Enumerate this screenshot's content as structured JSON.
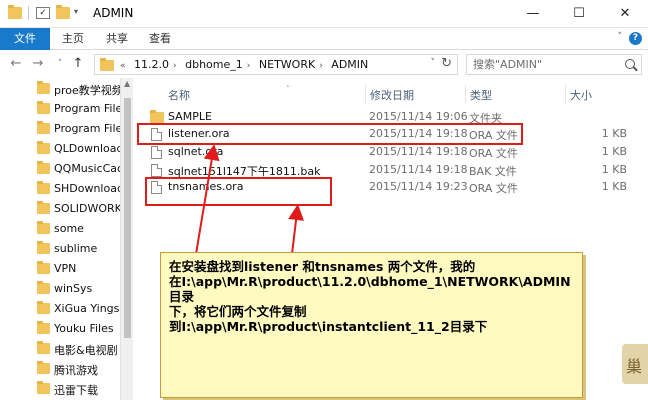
{
  "window": {
    "title": "ADMIN",
    "controls": {
      "minimize": "—",
      "maximize": "☐",
      "close": "✕"
    }
  },
  "ribbon": {
    "tabs": [
      "文件",
      "主页",
      "共享",
      "查看"
    ],
    "collapse_glyph": "˅",
    "help_glyph": "?"
  },
  "nav": {
    "back": "←",
    "forward": "→",
    "recent": "˅",
    "up": "↑",
    "overflow": "«",
    "breadcrumbs": [
      "11.2.0",
      "dbhome_1",
      "NETWORK",
      "ADMIN"
    ],
    "search_placeholder": "搜索\"ADMIN\""
  },
  "sidebar": {
    "items": [
      "proe教学视频",
      "Program Files",
      "Program Files",
      "QLDownload",
      "QQMusicCache",
      "SHDownload",
      "SOLIDWORKS",
      "some",
      "sublime",
      "VPN",
      "winSys",
      "XiGua Yingshi",
      "Youku Files",
      "电影&电视剧",
      "腾讯游戏",
      "迅雷下载"
    ]
  },
  "columns": {
    "name": "名称",
    "date": "修改日期",
    "type": "类型",
    "size": "大小"
  },
  "files": [
    {
      "name": "SAMPLE",
      "date": "2015/11/14 19:06",
      "type": "文件夹",
      "size": "",
      "icon": "folder"
    },
    {
      "name": "listener.ora",
      "date": "2015/11/14 19:18",
      "type": "ORA 文件",
      "size": "1 KB",
      "icon": "file"
    },
    {
      "name": "sqlnet.ora",
      "date": "2015/11/14 19:18",
      "type": "ORA 文件",
      "size": "1 KB",
      "icon": "file"
    },
    {
      "name": "sqlnet151l147下午1811.bak",
      "date": "2015/11/14 19:18",
      "type": "BAK 文件",
      "size": "1 KB",
      "icon": "file"
    },
    {
      "name": "tnsnames.ora",
      "date": "2015/11/14 19:23",
      "type": "ORA 文件",
      "size": "1 KB",
      "icon": "file"
    }
  ],
  "annotation": {
    "lines": [
      "在安装盘找到listener 和tnsnames 两个文件，我的",
      "在I:\\app\\Mr.R\\product\\11.2.0\\dbhome_1\\NETWORK\\ADMIN目录",
      "下，将它们两个文件复制",
      "到I:\\app\\Mr.R\\product\\instantclient_11_2目录下"
    ]
  },
  "colors": {
    "accent": "#1979ca",
    "highlight": "#e01b1b",
    "note_bg": "#fffac0"
  }
}
